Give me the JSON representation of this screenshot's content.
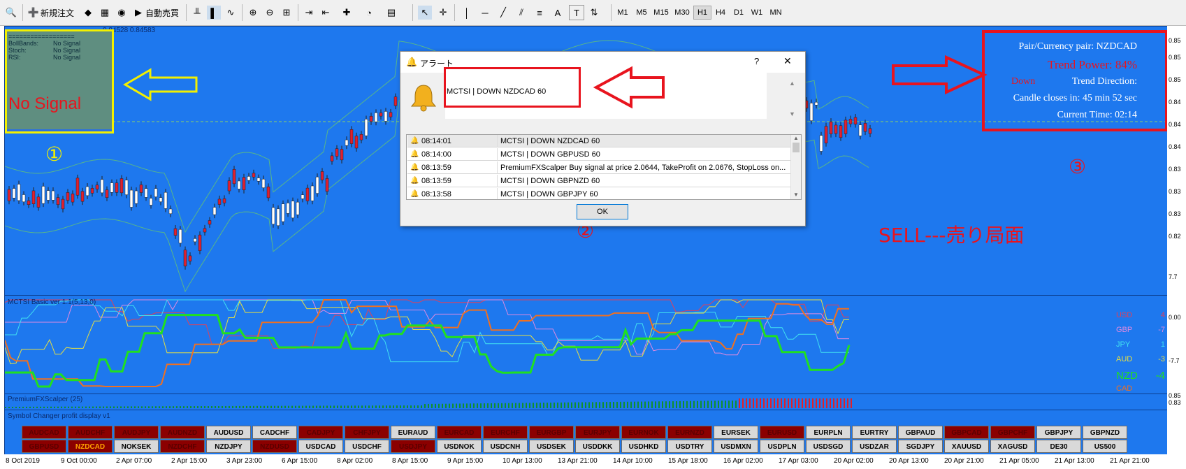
{
  "toolbar": {
    "new_order": "新規注文",
    "auto_trading": "自動売買",
    "timeframes": [
      "M1",
      "M5",
      "M15",
      "M30",
      "H1",
      "H4",
      "D1",
      "W1",
      "MN"
    ],
    "selected_timeframe": "H1",
    "letter_tools": [
      "A",
      "T"
    ]
  },
  "left_panel": {
    "header": "==================",
    "rows": [
      {
        "label": "BollBands:",
        "value": "No Signal"
      },
      {
        "label": "Stoch:",
        "value": "No Signal"
      },
      {
        "label": "RSI:",
        "value": "No Signal"
      }
    ],
    "big_text": "No Signal"
  },
  "chart_header": "0.84528 0.84583",
  "annotations": {
    "one": "①",
    "two": "②",
    "three": "③",
    "sell_text": "SELL---売り局面"
  },
  "trend_panel": {
    "pair": "Pair/Currency pair: NZDCAD",
    "power": "Trend Power: 84%",
    "direction_value": "Down",
    "direction_label": "Trend Direction:",
    "candle": "Candle closes in: 45 min 52 sec",
    "time": "Current Time: 02:14"
  },
  "dialog": {
    "title": "アラート",
    "help": "?",
    "close": "✕",
    "message": "MCTSI | DOWN NZDCAD 60",
    "rows": [
      {
        "time": "08:14:01",
        "text": "MCTSI | DOWN NZDCAD 60",
        "selected": true
      },
      {
        "time": "08:14:00",
        "text": "MCTSI | DOWN GBPUSD 60",
        "selected": false
      },
      {
        "time": "08:13:59",
        "text": "PremiumFXScalper Buy signal at price 2.0644, TakeProfit on 2.0676, StopLoss on...",
        "selected": false
      },
      {
        "time": "08:13:59",
        "text": "MCTSI | DOWN GBPNZD 60",
        "selected": false
      },
      {
        "time": "08:13:58",
        "text": "MCTSI | DOWN GBPJPY 60",
        "selected": false
      }
    ],
    "ok": "OK"
  },
  "indicator1": {
    "title": "MCTSI Basic ver 1.1(5,13,0)",
    "legend": [
      {
        "name": "USD",
        "value": "4",
        "color": "#e0405a"
      },
      {
        "name": "GBP",
        "value": "-7",
        "color": "#e08ae0"
      },
      {
        "name": "JPY",
        "value": "1",
        "color": "#40e0f0"
      },
      {
        "name": "AUD",
        "value": "-3",
        "color": "#e8e040"
      },
      {
        "name": "NZD",
        "value": "-4",
        "color": "#20e020"
      },
      {
        "name": "CAD",
        "value": "",
        "color": "#f07020"
      }
    ]
  },
  "indicator2": {
    "title": "PremiumFXScalper (25)"
  },
  "symbol_panel": {
    "title": "Symbol Changer profit display  v1",
    "row1": [
      {
        "s": "AUDCAD",
        "c": "red"
      },
      {
        "s": "AUDCHF",
        "c": "red"
      },
      {
        "s": "AUDJPY",
        "c": "red"
      },
      {
        "s": "AUDNZD",
        "c": "red"
      },
      {
        "s": "AUDUSD",
        "c": "grey"
      },
      {
        "s": "CADCHF",
        "c": "grey"
      },
      {
        "s": "CADJPY",
        "c": "red"
      },
      {
        "s": "CHFJPY",
        "c": "red"
      },
      {
        "s": "EURAUD",
        "c": "grey"
      },
      {
        "s": "EURCAD",
        "c": "red"
      },
      {
        "s": "EURCHF",
        "c": "red"
      },
      {
        "s": "EURGBP",
        "c": "red"
      },
      {
        "s": "EURJPY",
        "c": "red"
      },
      {
        "s": "EURNOK",
        "c": "red"
      },
      {
        "s": "EURNZD",
        "c": "red"
      },
      {
        "s": "EURSEK",
        "c": "grey"
      },
      {
        "s": "EURUSD",
        "c": "red"
      },
      {
        "s": "EURPLN",
        "c": "grey"
      },
      {
        "s": "EURTRY",
        "c": "grey"
      },
      {
        "s": "GBPAUD",
        "c": "grey"
      },
      {
        "s": "GBPCAD",
        "c": "red"
      },
      {
        "s": "GBPCHF",
        "c": "red"
      },
      {
        "s": "GBPJPY",
        "c": "grey"
      },
      {
        "s": "GBPNZD",
        "c": "grey"
      }
    ],
    "row2": [
      {
        "s": "GBPUSD",
        "c": "red"
      },
      {
        "s": "NZDCAD",
        "c": "hl"
      },
      {
        "s": "NOKSEK",
        "c": "grey"
      },
      {
        "s": "NZDCHF",
        "c": "red"
      },
      {
        "s": "NZDJPY",
        "c": "grey"
      },
      {
        "s": "NZDUSD",
        "c": "red"
      },
      {
        "s": "USDCAD",
        "c": "grey"
      },
      {
        "s": "USDCHF",
        "c": "grey"
      },
      {
        "s": "USDJPY",
        "c": "red"
      },
      {
        "s": "USDNOK",
        "c": "grey"
      },
      {
        "s": "USDCNH",
        "c": "grey"
      },
      {
        "s": "USDSEK",
        "c": "grey"
      },
      {
        "s": "USDDKK",
        "c": "grey"
      },
      {
        "s": "USDHKD",
        "c": "grey"
      },
      {
        "s": "USDTRY",
        "c": "grey"
      },
      {
        "s": "USDMXN",
        "c": "grey"
      },
      {
        "s": "USDPLN",
        "c": "grey"
      },
      {
        "s": "USDSGD",
        "c": "grey"
      },
      {
        "s": "USDZAR",
        "c": "grey"
      },
      {
        "s": "SGDJPY",
        "c": "grey"
      },
      {
        "s": "XAUUSD",
        "c": "grey"
      },
      {
        "s": "XAGUSD",
        "c": "grey"
      },
      {
        "s": "DE30",
        "c": "grey"
      },
      {
        "s": "US500",
        "c": "grey"
      }
    ]
  },
  "price_scale": [
    "0.85",
    "0.85",
    "0.85",
    "0.84",
    "0.84",
    "0.84",
    "0.83",
    "0.83",
    "0.83",
    "0.82",
    "7.7",
    "0.00",
    "-7.7",
    "0.85",
    "0.83"
  ],
  "time_axis": [
    "8 Oct 2019",
    "9 Oct 00:00",
    "2 Apr 07:00",
    "2 Apr 15:00",
    "3 Apr 23:00",
    "6 Apr 15:00",
    "8 Apr 02:00",
    "8 Apr 15:00",
    "9 Apr 15:00",
    "10 Apr 13:00",
    "13 Apr 21:00",
    "14 Apr 10:00",
    "15 Apr 18:00",
    "16 Apr 02:00",
    "17 Apr 03:00",
    "20 Apr 02:00",
    "20 Apr 13:00",
    "20 Apr 21:00",
    "21 Apr 05:00",
    "21 Apr 13:00",
    "21 Apr 21:00"
  ],
  "colors": {
    "chart_bg": "#1e78ee",
    "annotation_red": "#e8141e",
    "annotation_yellow": "#f2f000"
  }
}
